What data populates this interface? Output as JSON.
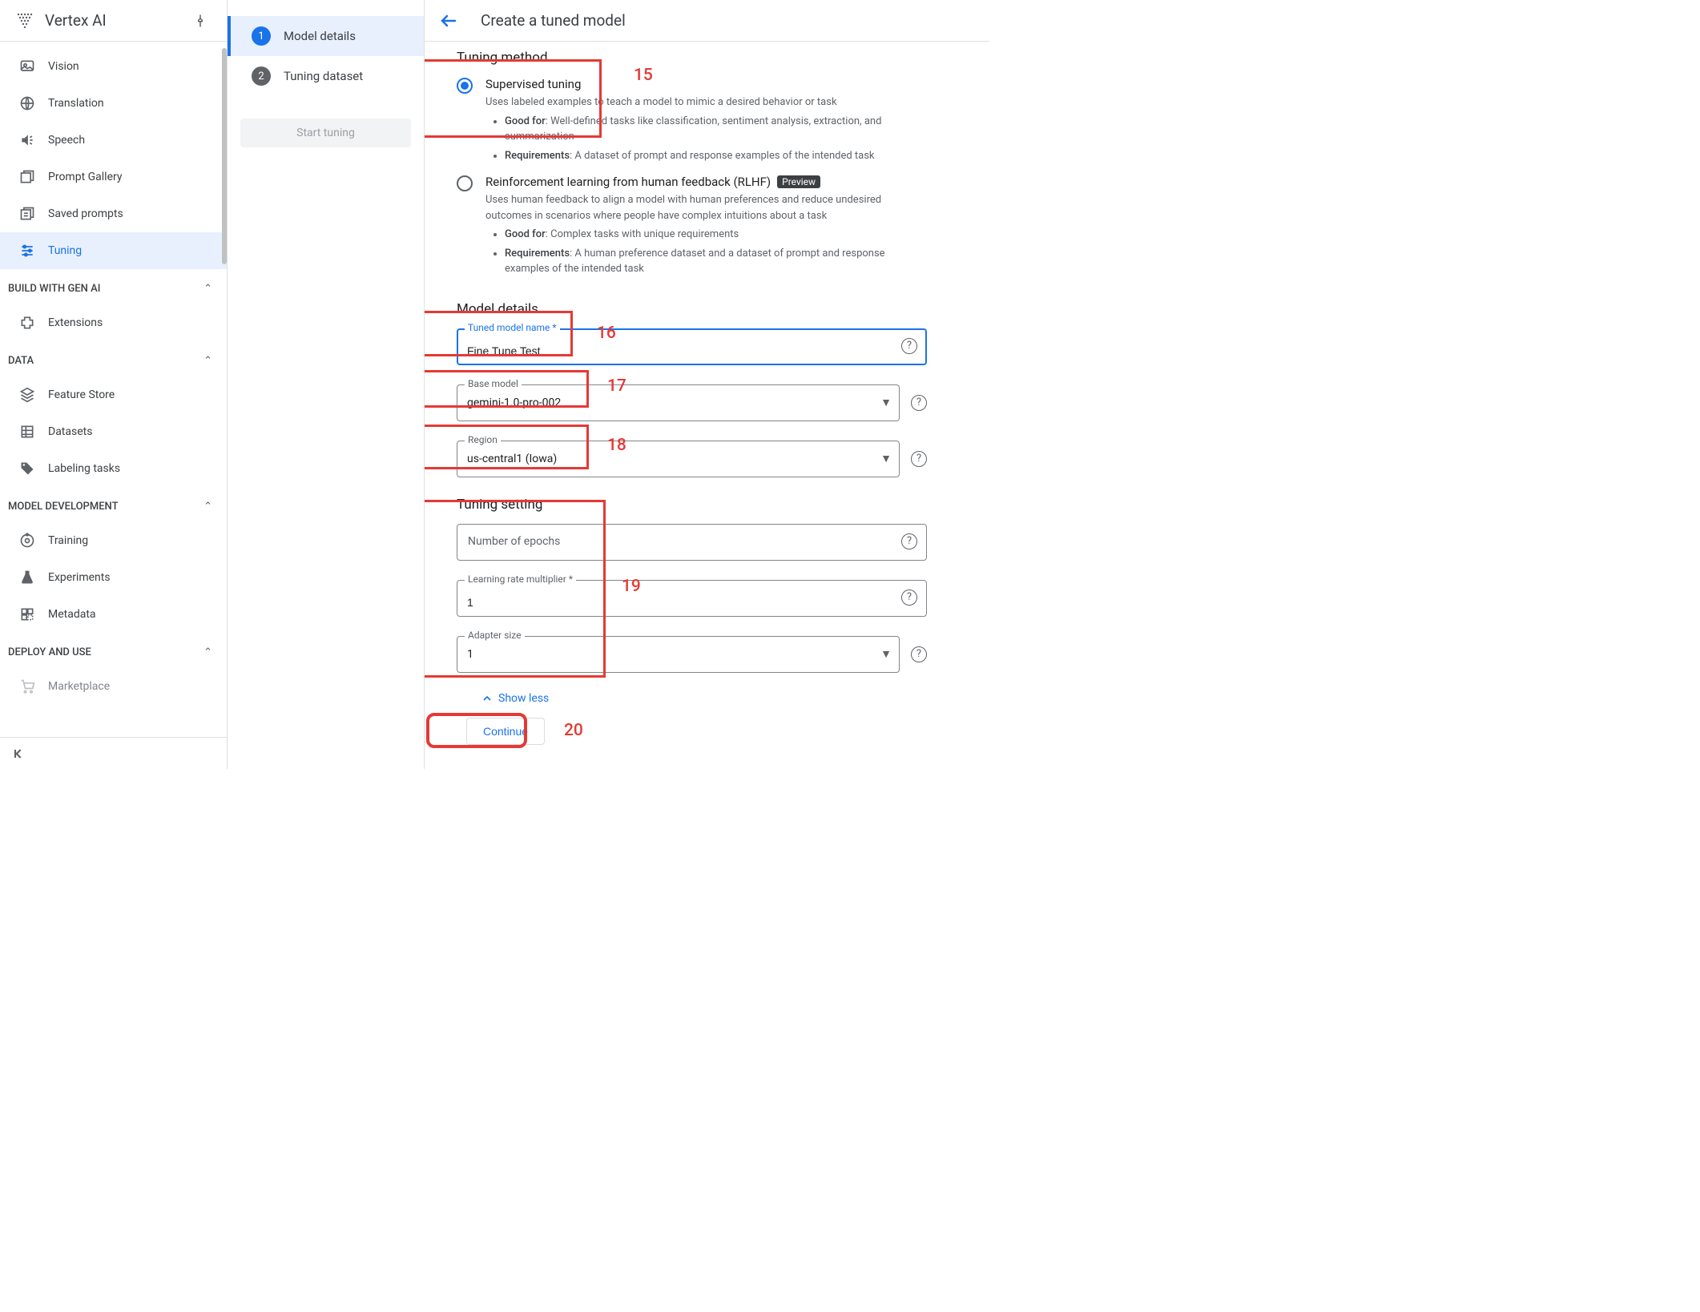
{
  "product": {
    "name": "Vertex AI"
  },
  "page": {
    "title": "Create a tuned model"
  },
  "sidebar": {
    "sections": [
      {
        "label": "BUILD WITH GEN AI"
      },
      {
        "label": "DATA"
      },
      {
        "label": "MODEL DEVELOPMENT"
      },
      {
        "label": "DEPLOY AND USE"
      }
    ],
    "items": {
      "vision": "Vision",
      "translation": "Translation",
      "speech": "Speech",
      "promptGallery": "Prompt Gallery",
      "savedPrompts": "Saved prompts",
      "tuning": "Tuning",
      "extensions": "Extensions",
      "featureStore": "Feature Store",
      "datasets": "Datasets",
      "labeling": "Labeling tasks",
      "training": "Training",
      "experiments": "Experiments",
      "metadata": "Metadata",
      "marketplace": "Marketplace"
    }
  },
  "stepper": {
    "step1": "Model details",
    "step2": "Tuning dataset",
    "start": "Start tuning"
  },
  "tuningMethod": {
    "heading": "Tuning method",
    "supervised": {
      "title": "Supervised tuning",
      "desc": "Uses labeled examples to teach a model to mimic a desired behavior or task",
      "goodFor": "Well-defined tasks like classification, sentiment analysis, extraction, and summarization",
      "req": "A dataset of prompt and response examples of the intended task"
    },
    "rlhf": {
      "title": "Reinforcement learning from human feedback (RLHF)",
      "badge": "Preview",
      "desc": "Uses human feedback to align a model with human preferences and reduce undesired outcomes in scenarios where people have complex intuitions about a task",
      "goodFor": "Complex tasks with unique requirements",
      "req": "A human preference dataset and a dataset of prompt and response examples of the intended task"
    },
    "goodForLabel": "Good for",
    "reqLabel": "Requirements"
  },
  "modelDetails": {
    "heading": "Model details",
    "name": {
      "label": "Tuned model name *",
      "value": "Fine Tune Test"
    },
    "base": {
      "label": "Base model",
      "value": "gemini-1.0-pro-002"
    },
    "region": {
      "label": "Region",
      "value": "us-central1 (Iowa)"
    }
  },
  "tuningSetting": {
    "heading": "Tuning setting",
    "epochs": {
      "label": "Number of epochs",
      "value": ""
    },
    "lr": {
      "label": "Learning rate multiplier *",
      "value": "1"
    },
    "adapter": {
      "label": "Adapter size",
      "value": "1"
    }
  },
  "actions": {
    "showLess": "Show less",
    "continue": "Continue"
  },
  "annotations": {
    "a15": "15",
    "a16": "16",
    "a17": "17",
    "a18": "18",
    "a19": "19",
    "a20": "20"
  }
}
